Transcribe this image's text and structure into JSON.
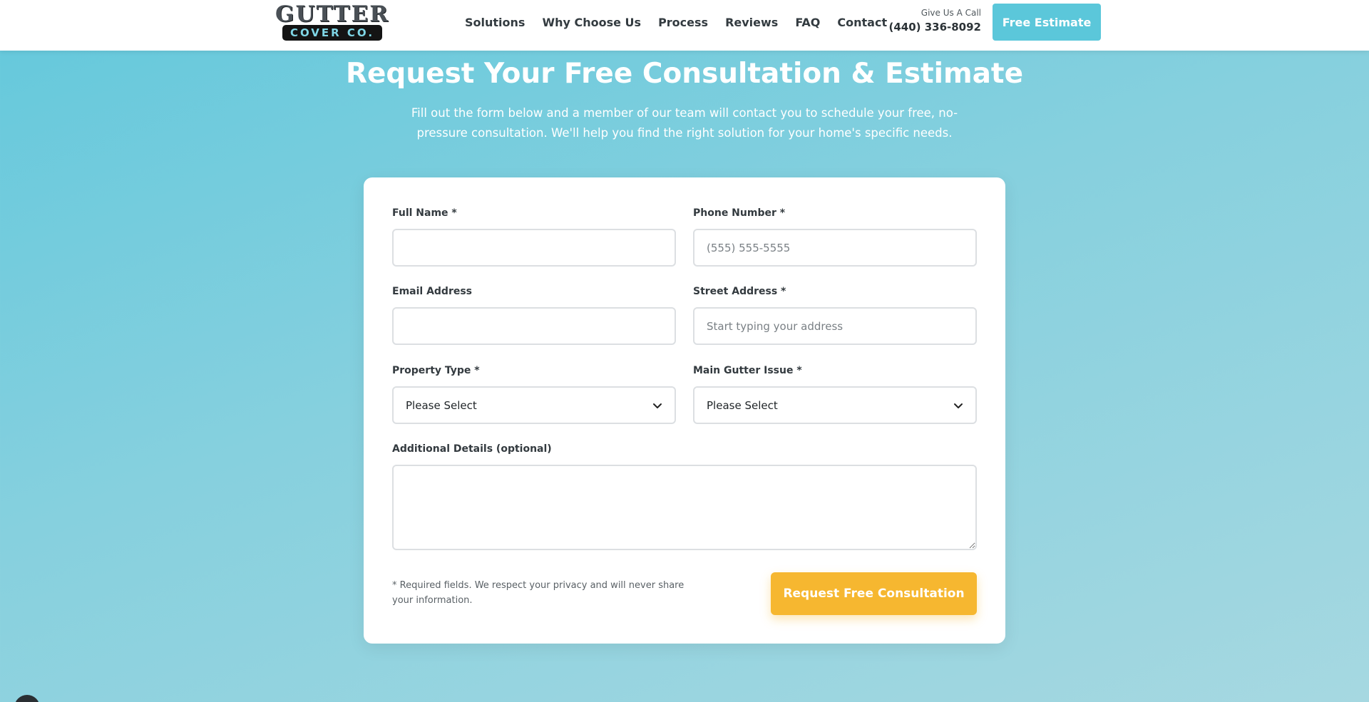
{
  "header": {
    "logo_top": "GUTTER",
    "logo_bottom": "COVER CO.",
    "nav": [
      "Solutions",
      "Why Choose Us",
      "Process",
      "Reviews",
      "FAQ",
      "Contact"
    ],
    "call_label": "Give Us A Call",
    "phone": "(440) 336-8092",
    "cta_label": "Free Estimate"
  },
  "hero": {
    "title": "Request Your Free Consultation & Estimate",
    "subtitle": "Fill out the form below and a member of our team will contact you to schedule your free, no-pressure consultation. We'll help you find the right solution for your home's specific needs."
  },
  "form": {
    "full_name": {
      "label": "Full Name *",
      "value": "",
      "placeholder": ""
    },
    "phone": {
      "label": "Phone Number *",
      "value": "",
      "placeholder": "(555) 555-5555"
    },
    "email": {
      "label": "Email Address",
      "value": "",
      "placeholder": ""
    },
    "street": {
      "label": "Street Address *",
      "value": "",
      "placeholder": "Start typing your address"
    },
    "property_type": {
      "label": "Property Type *",
      "selected": "Please Select"
    },
    "gutter_issue": {
      "label": "Main Gutter Issue *",
      "selected": "Please Select"
    },
    "details": {
      "label": "Additional Details (optional)",
      "value": ""
    },
    "note": "* Required fields. We respect your privacy and will never share your information.",
    "submit_label": "Request Free Consultation"
  },
  "colors": {
    "accent": "#5bc7da",
    "submit": "#f6b730",
    "text_dark": "#333a3f"
  }
}
